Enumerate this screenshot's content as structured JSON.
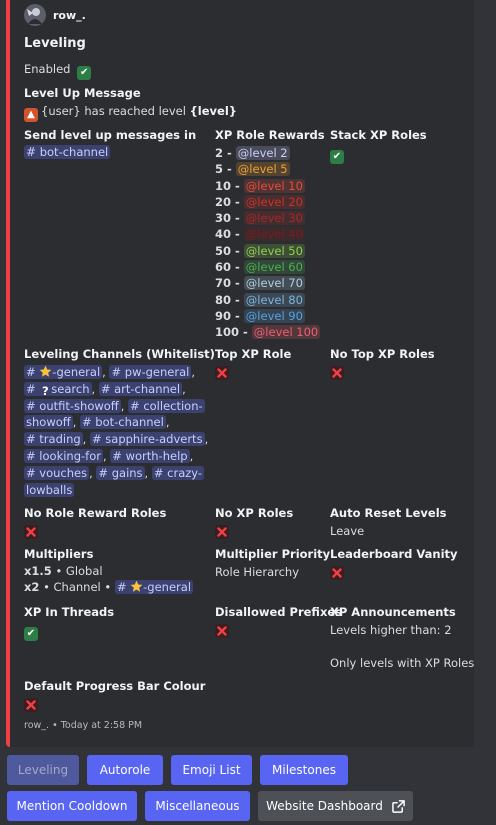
{
  "author": {
    "name": "row_."
  },
  "embed": {
    "title": "Leveling"
  },
  "status": {
    "label": "Enabled"
  },
  "level_up": {
    "label": "Level Up Message",
    "message_prefix": "{user} has reached level ",
    "message_var": "{level}"
  },
  "send_in": {
    "label": "Send level up messages in",
    "channel": "bot-channel"
  },
  "xp_role_rewards": {
    "label": "XP Role Rewards",
    "items": [
      {
        "level": "2",
        "role": "@level 2",
        "color": "#c9cdfb"
      },
      {
        "level": "5",
        "role": "@level 5",
        "color": "#f0a030"
      },
      {
        "level": "10",
        "role": "@level 10",
        "color": "#e84c3d"
      },
      {
        "level": "20",
        "role": "@level 20",
        "color": "#c83228"
      },
      {
        "level": "30",
        "role": "@level 30",
        "color": "#a8282a"
      },
      {
        "level": "40",
        "role": "@level 40",
        "color": "#7a1c1c"
      },
      {
        "level": "50",
        "role": "@level 50",
        "color": "#8fd14f"
      },
      {
        "level": "60",
        "role": "@level 60",
        "color": "#4caf50"
      },
      {
        "level": "70",
        "role": "@level 70",
        "color": "#b0cde0"
      },
      {
        "level": "80",
        "role": "@level 80",
        "color": "#7eb4de"
      },
      {
        "level": "90",
        "role": "@level 90",
        "color": "#5aa0dc"
      },
      {
        "level": "100",
        "role": "@level 100",
        "color": "#ef5f70"
      }
    ]
  },
  "stack_xp_roles": {
    "label": "Stack XP Roles"
  },
  "leveling_channels": {
    "label": "Leveling Channels (Whitelist)",
    "channels": [
      "-general",
      "pw-general",
      "search",
      "art-channel",
      "outfit-showoff",
      "collection-",
      "showoff",
      "bot-channel",
      "trading",
      "sapphire-adverts",
      "looking-for",
      "worth-help",
      "vouches",
      "gains",
      "crazy-",
      "lowballs"
    ]
  },
  "top_xp_role": {
    "label": "Top XP Role"
  },
  "no_top_xp_roles": {
    "label": "No Top XP Roles"
  },
  "no_role_reward_roles": {
    "label": "No Role Reward Roles"
  },
  "no_xp_roles": {
    "label": "No XP Roles"
  },
  "auto_reset": {
    "label": "Auto Reset Levels",
    "value": "Leave"
  },
  "multipliers": {
    "label": "Multipliers",
    "row1": {
      "mult": "x1.5",
      "desc": "Global"
    },
    "row2": {
      "mult": "x2",
      "desc": "Channel",
      "channel": "-general"
    }
  },
  "multiplier_priority": {
    "label": "Multiplier Priority",
    "value": "Role Hierarchy"
  },
  "leaderboard_vanity": {
    "label": "Leaderboard Vanity"
  },
  "xp_in_threads": {
    "label": "XP In Threads"
  },
  "disallowed_prefixes": {
    "label": "Disallowed Prefixes"
  },
  "xp_announcements": {
    "label": "XP Announcements",
    "line1": "Levels higher than: 2",
    "line2": "Only levels with XP Roles"
  },
  "progress_bar": {
    "label": "Default Progress Bar Colour"
  },
  "footer": {
    "author": "row_.",
    "sep": "•",
    "time": "Today at 2:58 PM"
  },
  "buttons": {
    "leveling": "Leveling",
    "autorole": "Autorole",
    "emoji_list": "Emoji List",
    "milestones": "Milestones",
    "mention_cooldown": "Mention Cooldown",
    "miscellaneous": "Miscellaneous",
    "website_dashboard": "Website Dashboard"
  },
  "colors": {
    "accent": "#f23f43",
    "primary": "#5865f2",
    "secondary": "#4e5058",
    "mention_bg": "#3c4270"
  }
}
